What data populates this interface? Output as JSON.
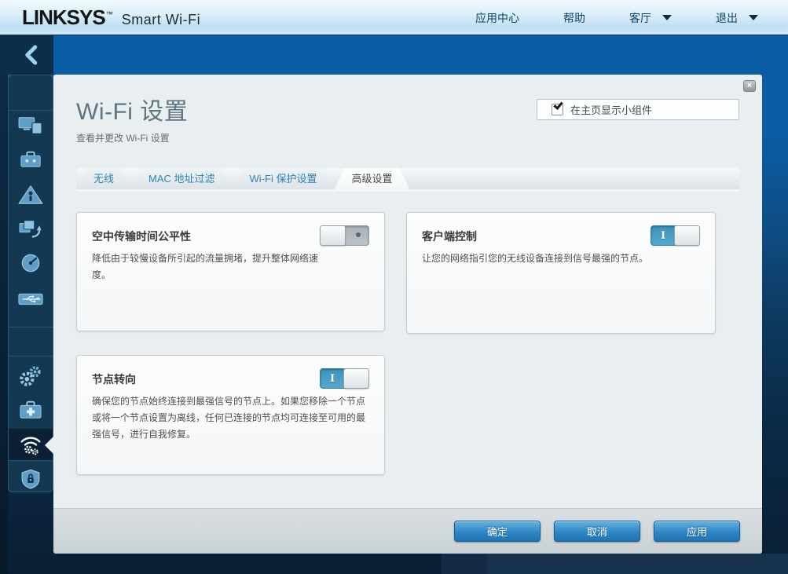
{
  "header": {
    "logo": "LINKSYS",
    "logo_tm": "™",
    "product": "Smart Wi-Fi",
    "nav": [
      {
        "label": "应用中心",
        "dropdown": false
      },
      {
        "label": "帮助",
        "dropdown": false
      },
      {
        "label": "客厅",
        "dropdown": true
      },
      {
        "label": "退出",
        "dropdown": true
      }
    ]
  },
  "sidebar": {
    "items": [
      {
        "icon": "devices-icon",
        "active": false
      },
      {
        "icon": "guest-access-icon",
        "active": false
      },
      {
        "icon": "parental-controls-icon",
        "active": false
      },
      {
        "icon": "media-prioritization-icon",
        "active": false
      },
      {
        "icon": "speed-test-icon",
        "active": false
      },
      {
        "icon": "external-storage-icon",
        "active": false
      },
      {
        "icon": "connectivity-icon",
        "active": false
      },
      {
        "icon": "troubleshooting-icon",
        "active": false
      },
      {
        "icon": "wifi-settings-icon",
        "active": true
      },
      {
        "icon": "security-icon",
        "active": false
      }
    ]
  },
  "modal": {
    "title": "Wi-Fi 设置",
    "subtitle": "查看并更改 Wi-Fi 设置",
    "close_glyph": "×",
    "widget_checkbox": {
      "label": "在主页显示小组件",
      "checked": true
    },
    "tabs": [
      {
        "label": "无线",
        "active": false
      },
      {
        "label": "MAC 地址过滤",
        "active": false
      },
      {
        "label": "Wi-Fi 保护设置",
        "active": false
      },
      {
        "label": "高级设置",
        "active": true
      }
    ],
    "cards": [
      {
        "title": "空中传输时间公平性",
        "description": "降低由于较慢设备所引起的流量拥堵，提升整体网络速度。",
        "toggle_on": false
      },
      {
        "title": "客户端控制",
        "description": "让您的网络指引您的无线设备连接到信号最强的节点。",
        "toggle_on": true
      },
      {
        "title": "节点转向",
        "description": "确保您的节点始终连接到最强信号的节点上。如果您移除一个节点或将一个节点设置为离线，任何已连接的节点均可连接至可用的最强信号，进行自我修复。",
        "toggle_on": true
      }
    ],
    "toggle": {
      "on_label": "I",
      "off_symbol": "o"
    },
    "buttons": [
      {
        "label": "确定"
      },
      {
        "label": "取消"
      },
      {
        "label": "应用"
      }
    ]
  },
  "colors": {
    "accent_blue": "#0a5da5",
    "toggle_on": "#4aa0c8",
    "button_blue": "#2e86c4",
    "sidebar_navy": "#133852",
    "modal_bg": "#e9eef1"
  }
}
